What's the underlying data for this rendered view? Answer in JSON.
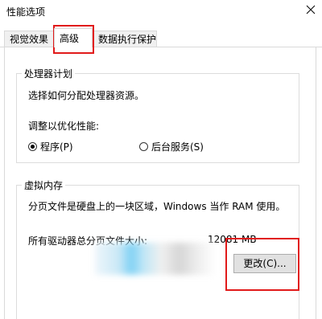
{
  "window": {
    "title": "性能选项"
  },
  "tabs": [
    {
      "label": "视觉效果"
    },
    {
      "label": "高级"
    },
    {
      "label": "数据执行保护"
    }
  ],
  "processor": {
    "legend": "处理器计划",
    "description": "选择如何分配处理器资源。",
    "adjust_label": "调整以优化性能:",
    "options": [
      {
        "label": "程序(P)",
        "selected": true
      },
      {
        "label": "后台服务(S)",
        "selected": false
      }
    ]
  },
  "virtual_memory": {
    "legend": "虚拟内存",
    "description": "分页文件是硬盘上的一块区域，Windows 当作 RAM 使用。",
    "total_label": "所有驱动器总分页文件大小:",
    "total_value": "12081 MB",
    "change_button": "更改(C)..."
  },
  "colors": {
    "highlight": "#e11a1a"
  }
}
